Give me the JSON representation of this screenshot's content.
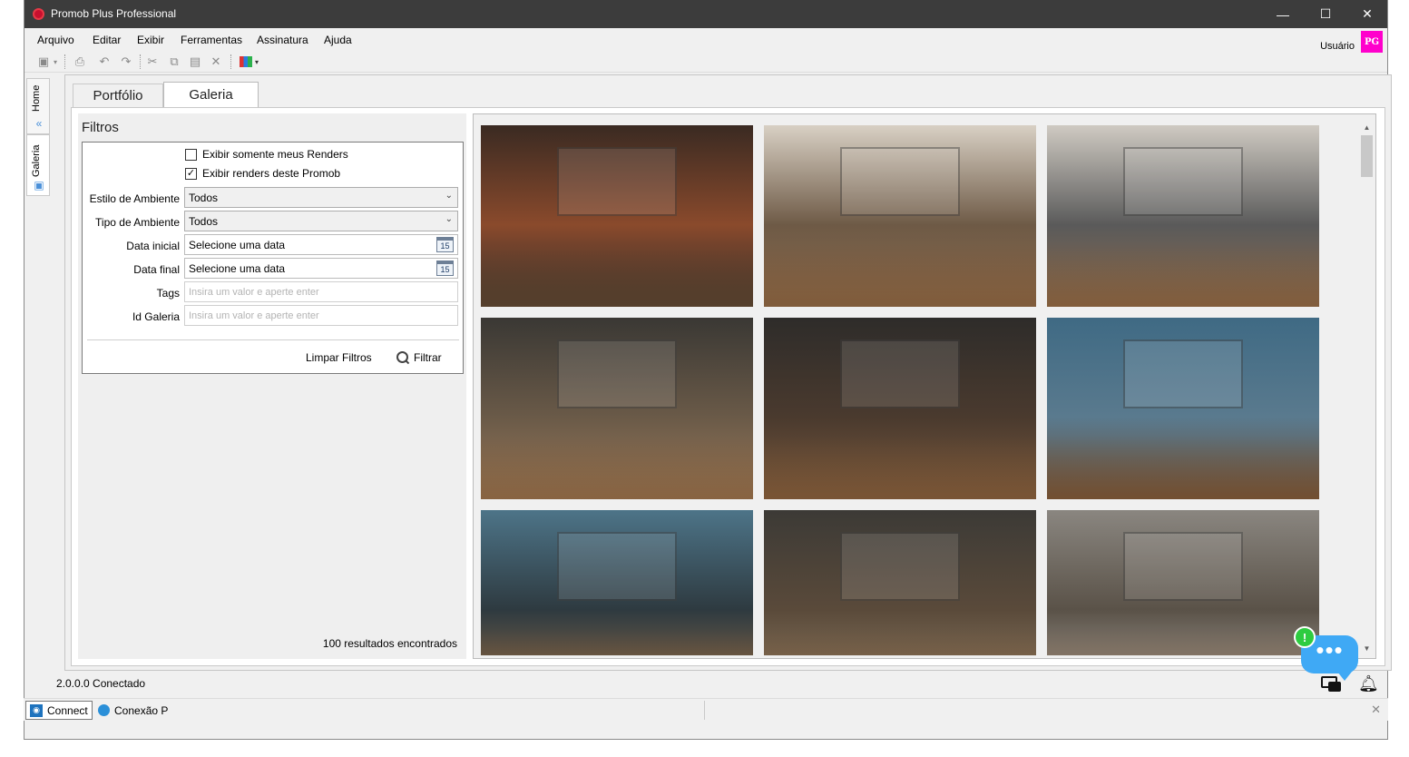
{
  "window": {
    "title": "Promob Plus Professional"
  },
  "window_controls": {
    "minimize": "—",
    "maximize": "☐",
    "close": "✕"
  },
  "menu": [
    "Arquivo",
    "Editar",
    "Exibir",
    "Ferramentas",
    "Assinatura",
    "Ajuda"
  ],
  "user": {
    "label": "Usuário",
    "initials": "PG",
    "avatar_color": "#ff00cc"
  },
  "side_tabs": {
    "home": "Home",
    "galeria": "Galeria"
  },
  "tabs": {
    "portfolio": "Portfólio",
    "galeria": "Galeria"
  },
  "filters": {
    "title": "Filtros",
    "only_my_renders": {
      "label": "Exibir somente meus Renders",
      "checked": false
    },
    "this_promob_renders": {
      "label": "Exibir renders deste Promob",
      "checked": true
    },
    "estilo": {
      "label": "Estilo de Ambiente",
      "value": "Todos"
    },
    "tipo": {
      "label": "Tipo de Ambiente",
      "value": "Todos"
    },
    "data_inicial": {
      "label": "Data inicial",
      "value": "Selecione uma data",
      "cal_day": "15"
    },
    "data_final": {
      "label": "Data final",
      "value": "Selecione uma data",
      "cal_day": "15"
    },
    "tags": {
      "label": "Tags",
      "placeholder": "Insira um valor e aperte enter"
    },
    "id_galeria": {
      "label": "Id Galeria",
      "placeholder": "Insira um valor e aperte enter"
    },
    "clear_label": "Limpar Filtros",
    "filter_label": "Filtrar",
    "results": "100 resultados encontrados"
  },
  "gallery": {
    "thumbnails": [
      {
        "name": "bathroom-copper-mirror",
        "colors": [
          "#3a2a22",
          "#8a4a2c",
          "#2b2b2b"
        ]
      },
      {
        "name": "kitchen-dining-bright",
        "colors": [
          "#d8d0c4",
          "#6e5a46",
          "#8a6a4c"
        ]
      },
      {
        "name": "kitchen-island-window",
        "colors": [
          "#cfcac2",
          "#5a5a5a",
          "#8c6c4e"
        ]
      },
      {
        "name": "dining-shelves-dark",
        "colors": [
          "#3a3834",
          "#6a5a48",
          "#9a7a5a"
        ]
      },
      {
        "name": "kitchen-dining-night",
        "colors": [
          "#2e2c2a",
          "#4a3a2e",
          "#7a5a3e"
        ]
      },
      {
        "name": "bathroom-blue-tiles",
        "colors": [
          "#3f6a84",
          "#5a7a8e",
          "#6b4e36"
        ]
      },
      {
        "name": "bathroom-tub-blue",
        "colors": [
          "#4d7488",
          "#2e3a40",
          "#8a6a4a"
        ]
      },
      {
        "name": "office-dark-wood",
        "colors": [
          "#3c3a36",
          "#5a4a3a",
          "#8c7a62"
        ]
      },
      {
        "name": "home-office-window",
        "colors": [
          "#8a8680",
          "#5a5248",
          "#a8a29a"
        ]
      }
    ]
  },
  "status": {
    "version": "2.0.0.0  Conectado"
  },
  "taskbar": {
    "connect": "Connect",
    "conexao": "Conexão P",
    "close": "✕"
  },
  "chat": {
    "dots": "•••",
    "alert": "!"
  }
}
